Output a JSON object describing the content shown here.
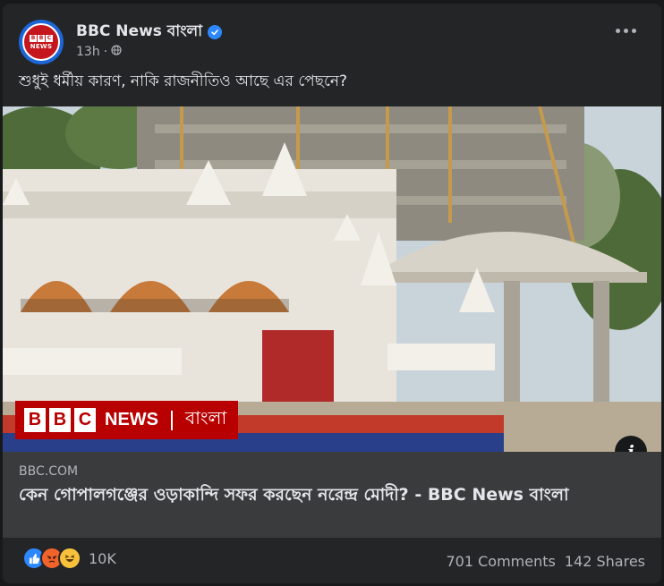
{
  "post": {
    "page_name": "BBC News বাংলা",
    "time": "13h",
    "caption": "শুধুই ধর্মীয় কারণ, নাকি রাজনীতিও আছে এর পেছনে?"
  },
  "avatar": {
    "bbc_letters": [
      "B",
      "B",
      "C"
    ],
    "news": "NEWS"
  },
  "image_overlay": {
    "bbc_letters": [
      "B",
      "B",
      "C"
    ],
    "news": "NEWS",
    "bangla": "বাংলা"
  },
  "link": {
    "domain": "BBC.COM",
    "title": "কেন গোপালগঞ্জের ওড়াকান্দি সফর করছেন নরেন্দ্র মোদী? - BBC News বাংলা"
  },
  "footer": {
    "reaction_count": "10K",
    "comments": "701 Comments",
    "shares": "142 Shares"
  },
  "colors": {
    "accent": "#2d88ff",
    "bbc_red": "#b80000",
    "card_bg": "#242526"
  }
}
